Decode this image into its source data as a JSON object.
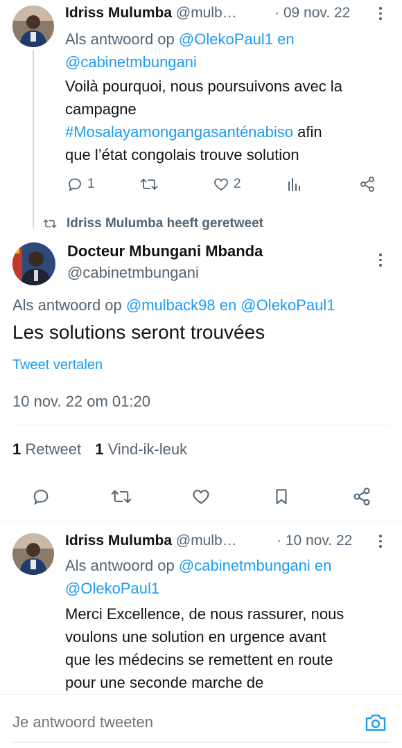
{
  "tweet1": {
    "name": "Idriss Mulumba",
    "handle": "@mulb…",
    "date": "· 09 nov. 22",
    "reply_prefix": "Als antwoord op",
    "reply_user1": "@OlekoPaul1",
    "reply_and": "en",
    "reply_user2": "@cabinetmbungani",
    "text_line1": "Voilà pourquoi, nous poursuivons avec la",
    "text_line2": "campagne",
    "hashtag": "#Mosalayamongangasanténabiso",
    "text_after_hashtag": "afin",
    "text_line4": "que l’état congolais trouve solution",
    "reply_count": "1",
    "like_count": "2"
  },
  "retweet_banner": "Idriss Mulumba heeft geretweet",
  "main_tweet": {
    "name": "Docteur Mbungani Mbanda",
    "handle": "@cabinetmbungani",
    "reply_prefix": "Als antwoord op",
    "reply_user1": "@mulback98",
    "reply_and": "en",
    "reply_user2": "@OlekoPaul1",
    "text": "Les solutions seront trouvées",
    "translate": "Tweet vertalen",
    "timestamp": "10 nov. 22 om 01:20",
    "retweets_count": "1",
    "retweets_label": "Retweet",
    "likes_count": "1",
    "likes_label": "Vind-ik-leuk"
  },
  "tweet3": {
    "name": "Idriss Mulumba",
    "handle": "@mulb…",
    "date": "· 10 nov. 22",
    "reply_prefix": "Als antwoord op",
    "reply_user1": "@cabinetmbungani",
    "reply_and": "en",
    "reply_user2": "@OlekoPaul1",
    "line1": "Merci Excellence, de nous rassurer, nous",
    "line2": "voulons une solution en urgence avant",
    "line3": "que les médecins se remettent en route",
    "line4": "pour une seconde marche de"
  },
  "composer": {
    "placeholder": "Je antwoord tweeten"
  },
  "colors": {
    "accent": "#1d9bf0",
    "muted": "#536471",
    "text": "#0f1419",
    "divider": "#eff3f4"
  }
}
